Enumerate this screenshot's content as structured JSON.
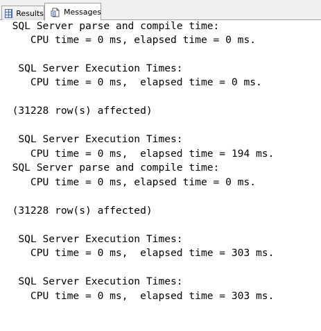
{
  "tabs": {
    "results_label": "Results",
    "messages_label": "Messages"
  },
  "messages": [
    "  SQL Server parse and compile time:",
    "     CPU time = 0 ms, elapsed time = 0 ms.",
    "",
    "   SQL Server Execution Times:",
    "     CPU time = 0 ms,  elapsed time = 0 ms.",
    "",
    "  (31228 row(s) affected)",
    "",
    "   SQL Server Execution Times:",
    "     CPU time = 0 ms,  elapsed time = 194 ms.",
    "  SQL Server parse and compile time:",
    "     CPU time = 0 ms, elapsed time = 0 ms.",
    "",
    "  (31228 row(s) affected)",
    "",
    "   SQL Server Execution Times:",
    "     CPU time = 0 ms,  elapsed time = 303 ms.",
    "",
    "   SQL Server Execution Times:",
    "     CPU time = 0 ms,  elapsed time = 303 ms."
  ]
}
